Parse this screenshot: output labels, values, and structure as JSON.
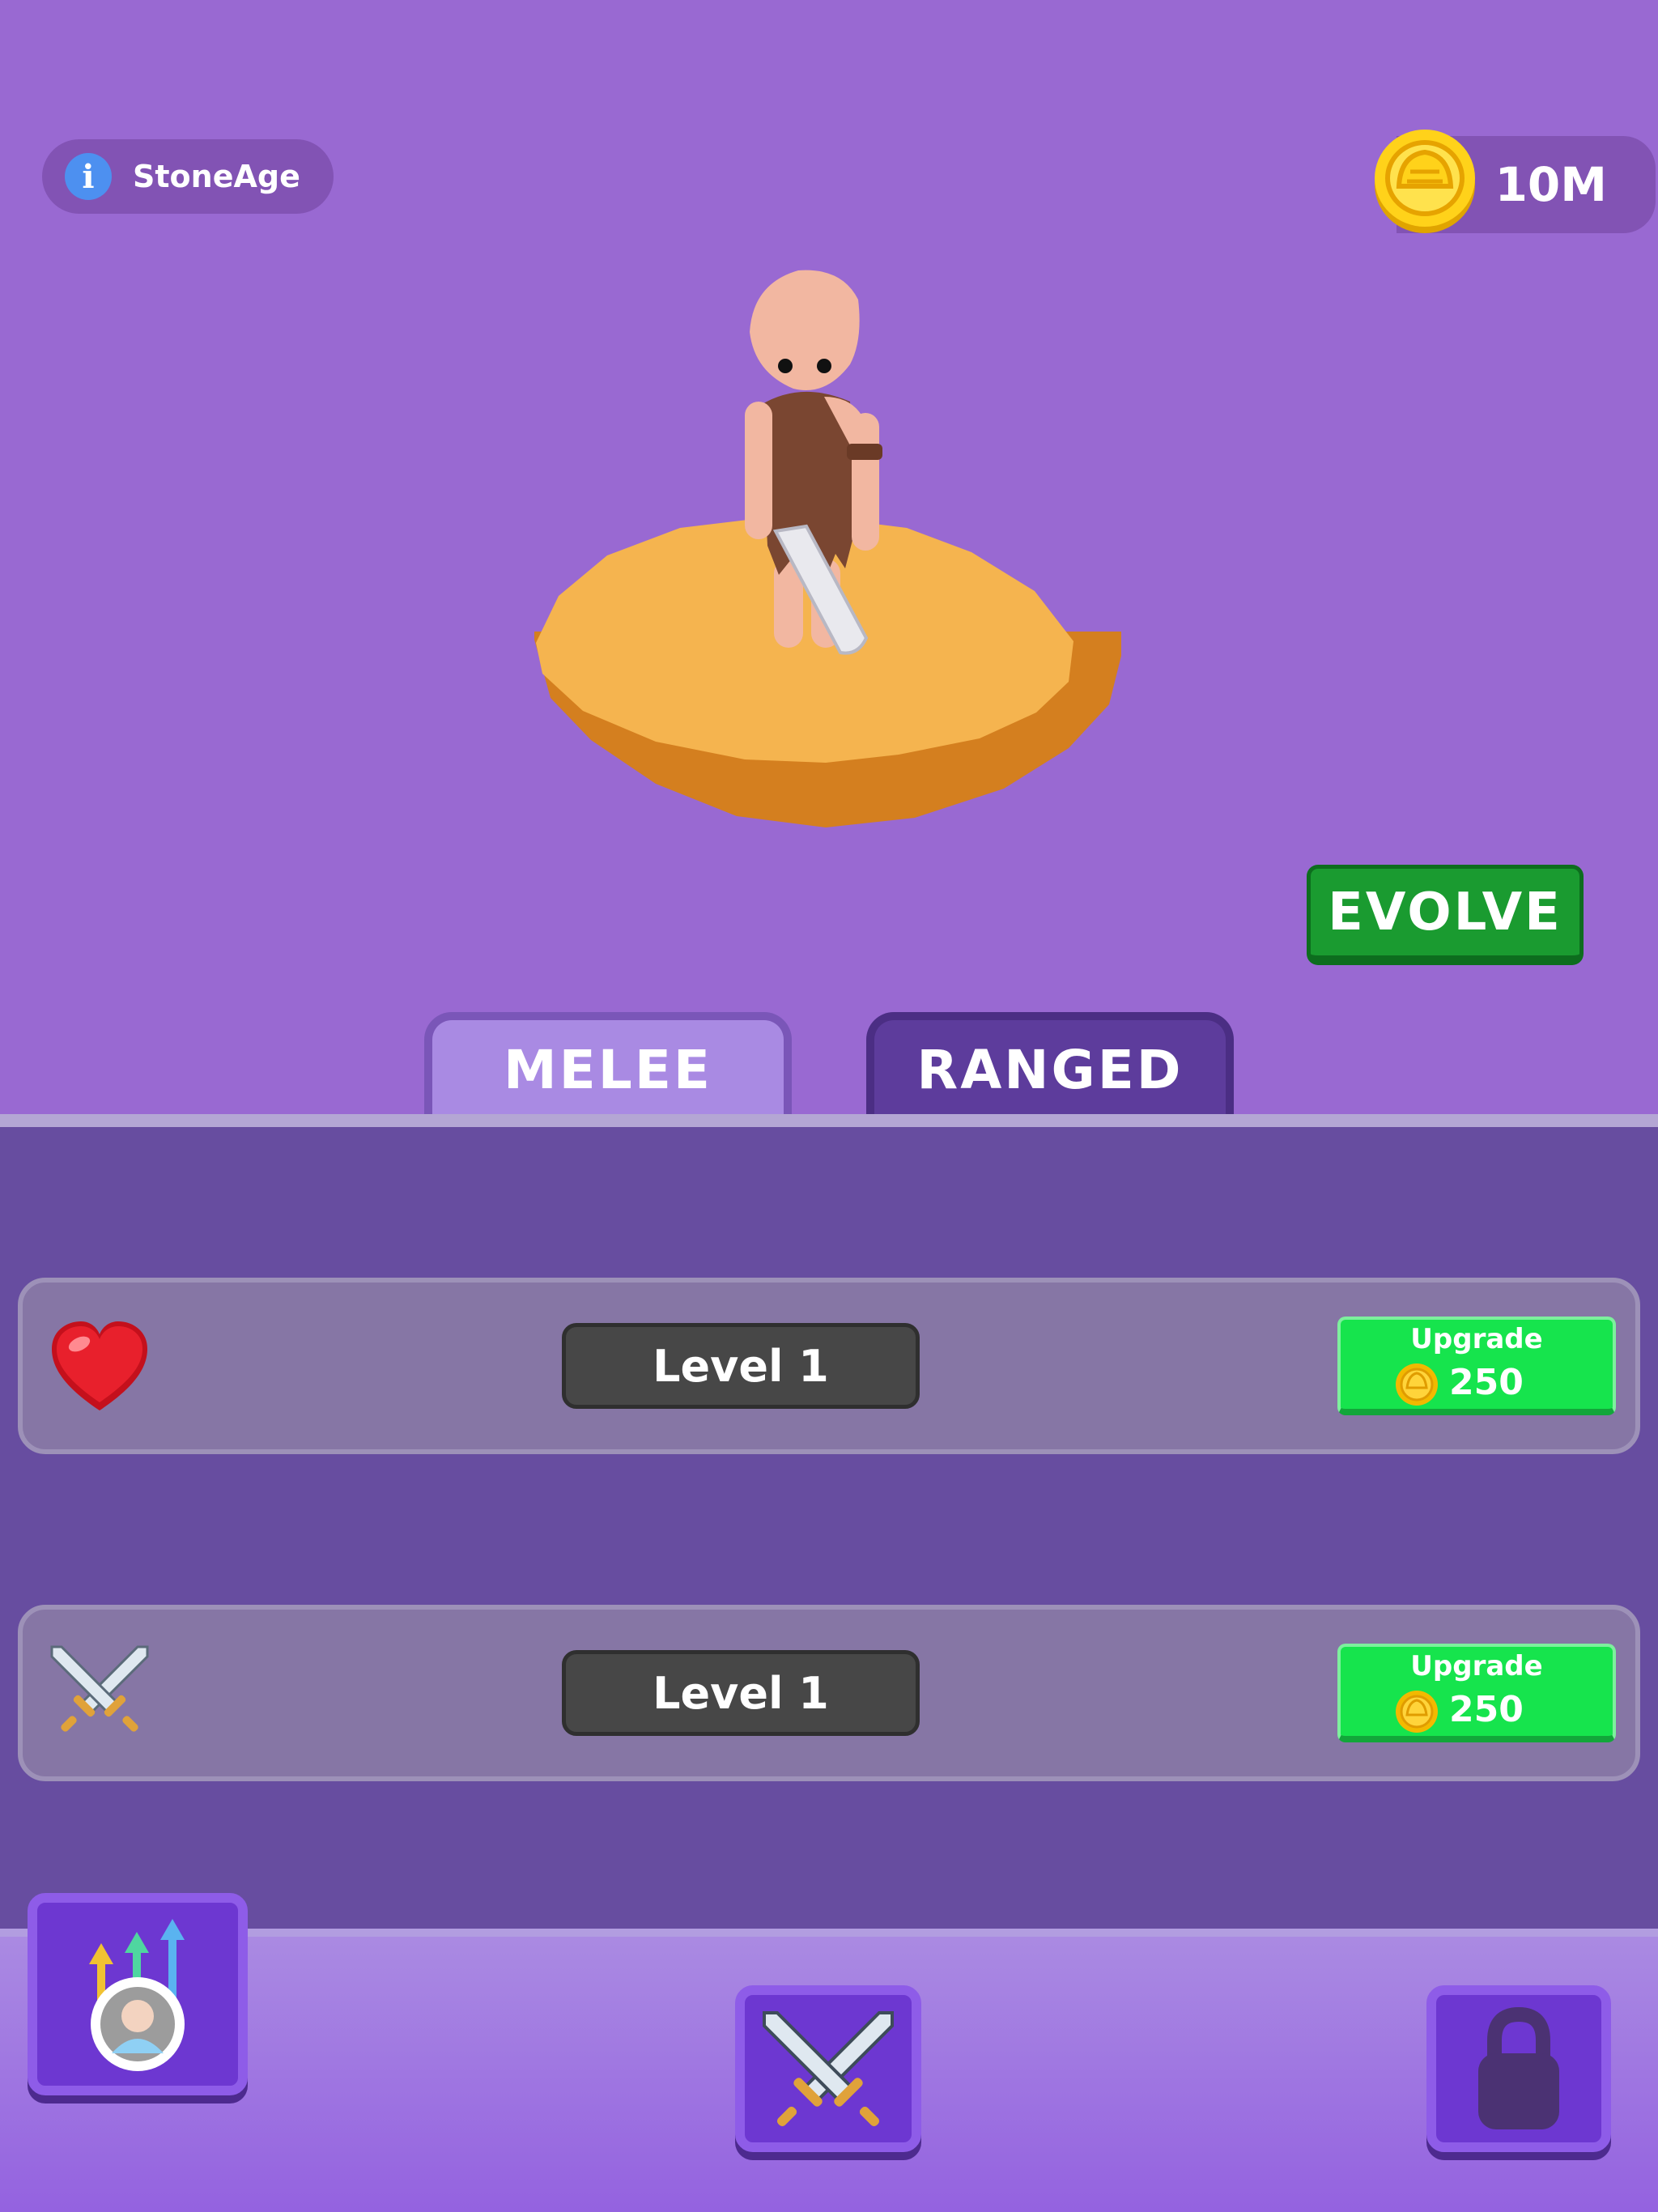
{
  "hud": {
    "era_label": "StoneAge",
    "info_icon": "info-icon",
    "coins": "10M",
    "coin_icon": "gold-coin-icon"
  },
  "stage": {
    "character": "caveman-with-club",
    "platform_color": "#f5b44f"
  },
  "actions": {
    "evolve_label": "EVOLVE"
  },
  "tabs": [
    {
      "label": "MELEE",
      "active": true
    },
    {
      "label": "RANGED",
      "active": false
    }
  ],
  "stats": [
    {
      "icon": "heart-icon",
      "level_label": "Level 1",
      "upgrade_label": "Upgrade",
      "cost": "250"
    },
    {
      "icon": "crossed-swords-icon",
      "level_label": "Level 1",
      "upgrade_label": "Upgrade",
      "cost": "250"
    }
  ],
  "bottom_nav": [
    {
      "icon": "evolution-progress-icon"
    },
    {
      "icon": "crossed-swords-icon"
    },
    {
      "icon": "lock-icon"
    }
  ],
  "colors": {
    "background": "#9969d2",
    "panel": "#674da0",
    "evolve_green": "#1a9b30",
    "upgrade_green": "#16e44d"
  }
}
